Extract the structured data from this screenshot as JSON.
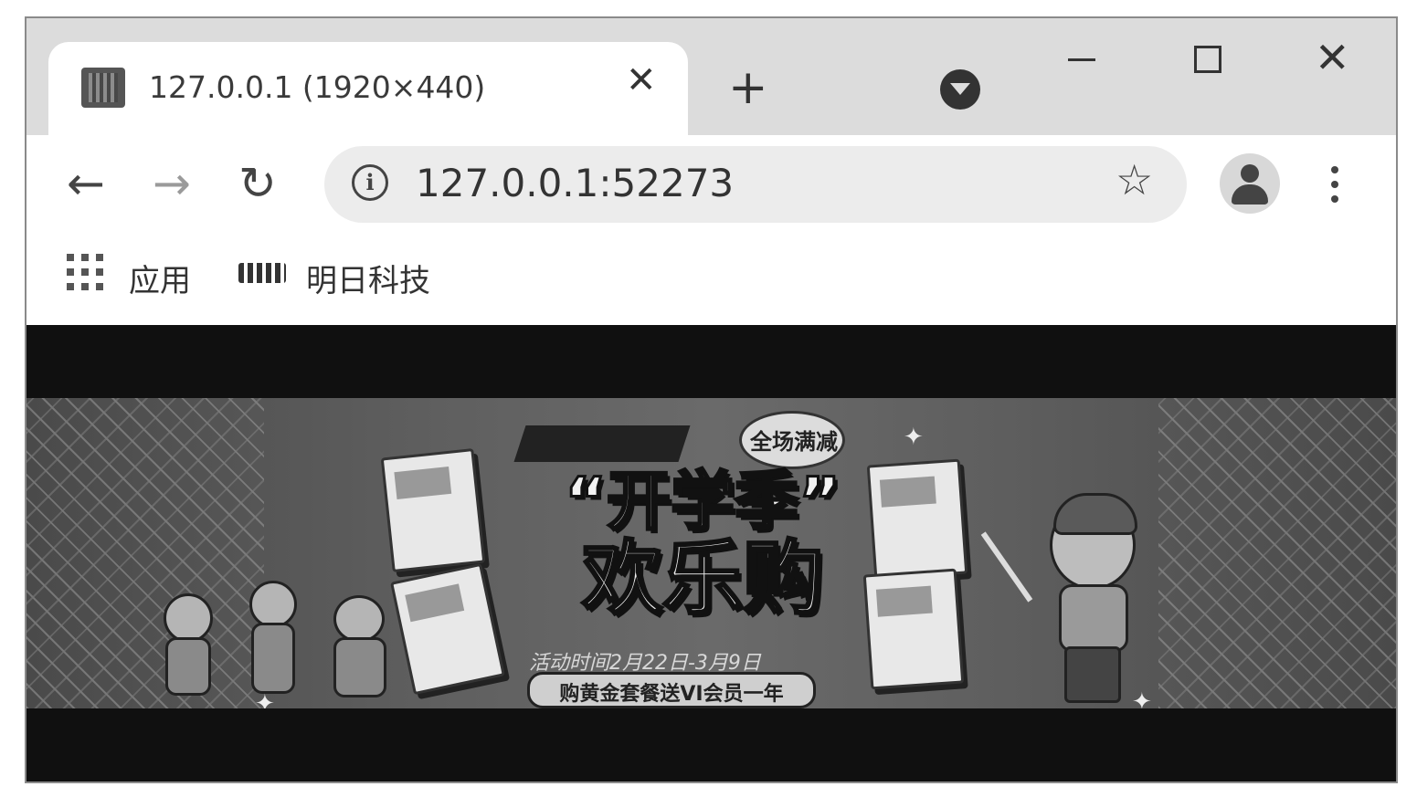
{
  "tab": {
    "title": "127.0.0.1 (1920×440)",
    "close_glyph": "✕",
    "favicon_icon": "site-favicon-icon"
  },
  "tabstrip": {
    "new_tab_glyph": "+",
    "tab_search_icon": "tab-search-icon"
  },
  "window_controls": {
    "close_glyph": "✕"
  },
  "toolbar": {
    "back_glyph": "←",
    "forward_glyph": "→",
    "reload_glyph": "↻",
    "info_glyph": "i",
    "url": "127.0.0.1:52273",
    "bookmark_glyph": "☆"
  },
  "bookmarks": {
    "apps_label": "应用",
    "mingri_label": "明日科技"
  },
  "banner": {
    "badge": "全场满减",
    "headline_line1": "“开学季”",
    "headline_line2": "欢乐购",
    "date": "活动时间2月22日-3月9日",
    "promo": "购黄金套餐送VI会员一年"
  },
  "colors": {
    "tabstrip_bg": "#dcdcdc",
    "omnibox_bg": "#ececec",
    "page_bg": "#101010"
  }
}
